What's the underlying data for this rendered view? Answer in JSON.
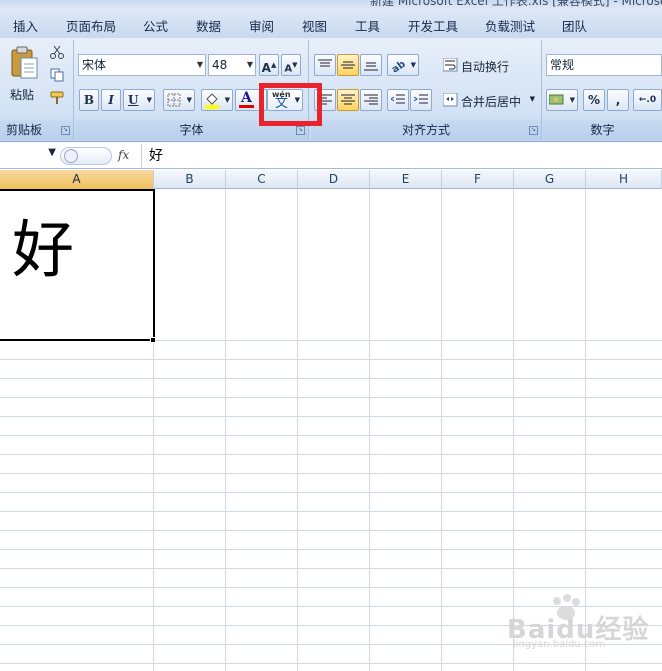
{
  "window": {
    "title": "新建 Microsoft Excel 工作表.xls [兼容模式] - Microsoft Excel"
  },
  "tabs": [
    "插入",
    "页面布局",
    "公式",
    "数据",
    "审阅",
    "视图",
    "工具",
    "开发工具",
    "负载测试",
    "团队"
  ],
  "clipboard": {
    "paste_label": "粘贴",
    "group_label": "剪贴板"
  },
  "font": {
    "name": "宋体",
    "size": "48",
    "group_label": "字体",
    "grow": "A",
    "shrink": "A",
    "bold": "B",
    "italic": "I",
    "underline": "U",
    "font_color": "A",
    "phonetic": "wén",
    "phonetic_char": "文"
  },
  "alignment": {
    "wrap_label": "自动换行",
    "merge_label": "合并后居中",
    "group_label": "对齐方式"
  },
  "number": {
    "format": "常规",
    "percent": "%",
    "comma": ",",
    "group_label": "数字"
  },
  "formula_bar": {
    "fx": "fx",
    "content": "好"
  },
  "columns": [
    "A",
    "B",
    "C",
    "D",
    "E",
    "F",
    "G",
    "H"
  ],
  "cell_a1": "好",
  "watermark": {
    "brand": "Baidu经验",
    "url": "jingyan.baidu.com"
  },
  "colors": {
    "highlight_box": "#e8232b",
    "selected_header": "#f1c15f"
  }
}
